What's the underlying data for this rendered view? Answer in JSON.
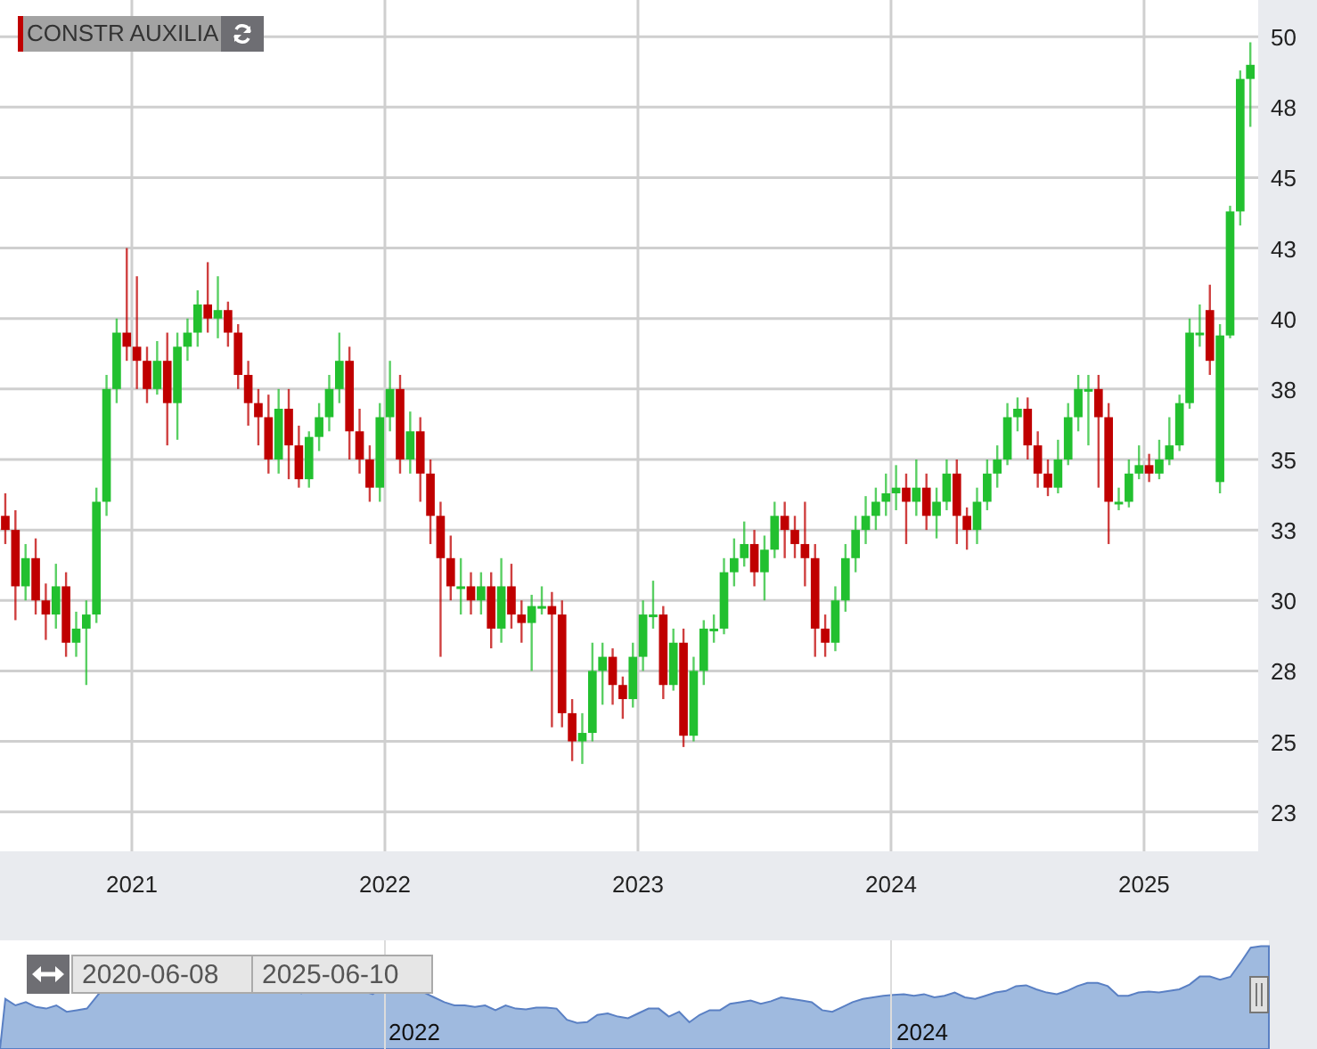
{
  "instrument_label": {
    "text": "CONSTR AUXILIA"
  },
  "chart_data": {
    "type": "candlestick",
    "grid": true,
    "xlim": [
      2020.479,
      2025.451
    ],
    "ylim": [
      21.1,
      51.3
    ],
    "xticks": [
      2021,
      2022,
      2023,
      2024,
      2025
    ],
    "x": [
      2020.5,
      2020.54,
      2020.58,
      2020.62,
      2020.66,
      2020.7,
      2020.74,
      2020.78,
      2020.82,
      2020.86,
      2020.9,
      2020.94,
      2020.98,
      2021.02,
      2021.06,
      2021.1,
      2021.14,
      2021.18,
      2021.22,
      2021.26,
      2021.3,
      2021.34,
      2021.38,
      2021.42,
      2021.46,
      2021.5,
      2021.54,
      2021.58,
      2021.62,
      2021.66,
      2021.7,
      2021.74,
      2021.78,
      2021.82,
      2021.86,
      2021.9,
      2021.94,
      2021.98,
      2022.02,
      2022.06,
      2022.1,
      2022.14,
      2022.18,
      2022.22,
      2022.26,
      2022.3,
      2022.34,
      2022.38,
      2022.42,
      2022.46,
      2022.5,
      2022.54,
      2022.58,
      2022.62,
      2022.66,
      2022.7,
      2022.74,
      2022.78,
      2022.82,
      2022.86,
      2022.9,
      2022.94,
      2022.98,
      2023.02,
      2023.06,
      2023.1,
      2023.14,
      2023.18,
      2023.22,
      2023.26,
      2023.3,
      2023.34,
      2023.38,
      2023.42,
      2023.46,
      2023.5,
      2023.54,
      2023.58,
      2023.62,
      2023.66,
      2023.7,
      2023.74,
      2023.78,
      2023.82,
      2023.86,
      2023.9,
      2023.94,
      2023.98,
      2024.02,
      2024.06,
      2024.1,
      2024.14,
      2024.18,
      2024.22,
      2024.26,
      2024.3,
      2024.34,
      2024.38,
      2024.42,
      2024.46,
      2024.5,
      2024.54,
      2024.58,
      2024.62,
      2024.66,
      2024.7,
      2024.74,
      2024.78,
      2024.82,
      2024.86,
      2024.9,
      2024.94,
      2024.98,
      2025.02,
      2025.06,
      2025.1,
      2025.14,
      2025.18,
      2025.22,
      2025.26,
      2025.3,
      2025.34,
      2025.38,
      2025.42
    ],
    "yticks": [
      {
        "value": 22.5,
        "label": "23"
      },
      {
        "value": 25,
        "label": "25"
      },
      {
        "value": 27.5,
        "label": "28"
      },
      {
        "value": 30,
        "label": "30"
      },
      {
        "value": 32.5,
        "label": "33"
      },
      {
        "value": 35,
        "label": "35"
      },
      {
        "value": 37.5,
        "label": "38"
      },
      {
        "value": 40,
        "label": "40"
      },
      {
        "value": 42.5,
        "label": "43"
      },
      {
        "value": 45,
        "label": "45"
      },
      {
        "value": 47.5,
        "label": "48"
      },
      {
        "value": 50,
        "label": "50"
      }
    ],
    "ohlc": [
      [
        33,
        33.8,
        32,
        32.5
      ],
      [
        32.5,
        33.2,
        29.3,
        30.5
      ],
      [
        30.5,
        32,
        30,
        31.5
      ],
      [
        31.5,
        32.2,
        29.5,
        30
      ],
      [
        30,
        30.6,
        28.6,
        29.5
      ],
      [
        29.5,
        31.3,
        29,
        30.5
      ],
      [
        30.5,
        31,
        28,
        28.5
      ],
      [
        28.5,
        29.6,
        28,
        29
      ],
      [
        29,
        30,
        27,
        29.5
      ],
      [
        29.5,
        34,
        29.2,
        33.5
      ],
      [
        33.5,
        38,
        33,
        37.5
      ],
      [
        37.5,
        40,
        37,
        39.5
      ],
      [
        39.5,
        42.5,
        38.5,
        39
      ],
      [
        39,
        41.5,
        37.5,
        38.5
      ],
      [
        38.5,
        39,
        37,
        37.5
      ],
      [
        37.5,
        39.2,
        37.3,
        38.5
      ],
      [
        38.5,
        39.5,
        35.5,
        37
      ],
      [
        37,
        39.5,
        35.7,
        39
      ],
      [
        39,
        40,
        38.5,
        39.5
      ],
      [
        39.5,
        41,
        39,
        40.5
      ],
      [
        40.5,
        42,
        39.5,
        40
      ],
      [
        40,
        41.5,
        39.3,
        40.3
      ],
      [
        40.3,
        40.6,
        39,
        39.5
      ],
      [
        39.5,
        39.8,
        37.5,
        38
      ],
      [
        38,
        38.5,
        36.2,
        37
      ],
      [
        37,
        37.5,
        35.5,
        36.5
      ],
      [
        36.5,
        37.3,
        34.5,
        35
      ],
      [
        35,
        37.5,
        34.5,
        36.8
      ],
      [
        36.8,
        37.5,
        34.3,
        35.5
      ],
      [
        35.5,
        36.2,
        34,
        34.3
      ],
      [
        34.3,
        36,
        34,
        35.8
      ],
      [
        35.8,
        37,
        35.3,
        36.5
      ],
      [
        36.5,
        38,
        36,
        37.5
      ],
      [
        37.5,
        39.5,
        37,
        38.5
      ],
      [
        38.5,
        39,
        35,
        36
      ],
      [
        36,
        36.8,
        34.5,
        35
      ],
      [
        35,
        35.5,
        33.5,
        34
      ],
      [
        34,
        37,
        33.5,
        36.5
      ],
      [
        36.5,
        38.5,
        36,
        37.5
      ],
      [
        37.5,
        38,
        34.5,
        35
      ],
      [
        35,
        36.7,
        34.5,
        36
      ],
      [
        36,
        36.5,
        33.5,
        34.5
      ],
      [
        34.5,
        35,
        32,
        33
      ],
      [
        33,
        33.5,
        28,
        31.5
      ],
      [
        31.5,
        32.3,
        30,
        30.5
      ],
      [
        30.5,
        31.5,
        29.5,
        30.5
      ],
      [
        30.5,
        31,
        29.5,
        30
      ],
      [
        30,
        31,
        29.5,
        30.5
      ],
      [
        30.5,
        31,
        28.3,
        29
      ],
      [
        29,
        31.5,
        28.5,
        30.5
      ],
      [
        30.5,
        31.3,
        29,
        29.5
      ],
      [
        29.5,
        30,
        28.5,
        29.2
      ],
      [
        29.2,
        30.2,
        27.5,
        29.8
      ],
      [
        29.8,
        30.5,
        29.5,
        29.8
      ],
      [
        29.8,
        30.3,
        25.5,
        29.5
      ],
      [
        29.5,
        30,
        25.5,
        26
      ],
      [
        26,
        26.5,
        24.3,
        25
      ],
      [
        25,
        26,
        24.2,
        25.3
      ],
      [
        25.3,
        28.5,
        25,
        27.5
      ],
      [
        27.5,
        28.5,
        26.3,
        28
      ],
      [
        28,
        28.3,
        26.3,
        27
      ],
      [
        27,
        27.3,
        25.8,
        26.5
      ],
      [
        26.5,
        28.5,
        26.2,
        28
      ],
      [
        28,
        30,
        27.5,
        29.5
      ],
      [
        29.5,
        30.7,
        29,
        29.5
      ],
      [
        29.5,
        29.8,
        26.5,
        27
      ],
      [
        27,
        29,
        26.8,
        28.5
      ],
      [
        28.5,
        29,
        24.8,
        25.2
      ],
      [
        25.2,
        28,
        25,
        27.5
      ],
      [
        27.5,
        29.3,
        27,
        29
      ],
      [
        29,
        29.5,
        28.5,
        29
      ],
      [
        29,
        31.5,
        28.8,
        31
      ],
      [
        31,
        32.2,
        30.5,
        31.5
      ],
      [
        31.5,
        32.8,
        31.2,
        32
      ],
      [
        32,
        32.5,
        30.5,
        31
      ],
      [
        31,
        32.3,
        30,
        31.8
      ],
      [
        31.8,
        33.5,
        31.5,
        33
      ],
      [
        33,
        33.5,
        31.5,
        32.5
      ],
      [
        32.5,
        33,
        31.5,
        32
      ],
      [
        32,
        33.5,
        30.5,
        31.5
      ],
      [
        31.5,
        32,
        28,
        29
      ],
      [
        29,
        29.5,
        28,
        28.5
      ],
      [
        28.5,
        30.5,
        28.2,
        30
      ],
      [
        30,
        32,
        29.6,
        31.5
      ],
      [
        31.5,
        33,
        31,
        32.5
      ],
      [
        32.5,
        33.7,
        32,
        33
      ],
      [
        33,
        34,
        32.5,
        33.5
      ],
      [
        33.5,
        34.5,
        33,
        33.8
      ],
      [
        33.8,
        34.8,
        33.2,
        34
      ],
      [
        34,
        34.5,
        32,
        33.5
      ],
      [
        33.5,
        35,
        33,
        34
      ],
      [
        34,
        34.5,
        32.5,
        33
      ],
      [
        33,
        34,
        32.2,
        33.5
      ],
      [
        33.5,
        35,
        33.2,
        34.5
      ],
      [
        34.5,
        35,
        32,
        33
      ],
      [
        33,
        33.3,
        31.8,
        32.5
      ],
      [
        32.5,
        34,
        32,
        33.5
      ],
      [
        33.5,
        35,
        33.2,
        34.5
      ],
      [
        34.5,
        35.5,
        34,
        35
      ],
      [
        35,
        37,
        34.8,
        36.5
      ],
      [
        36.5,
        37.2,
        36,
        36.8
      ],
      [
        36.8,
        37.2,
        35,
        35.5
      ],
      [
        35.5,
        36,
        34,
        34.5
      ],
      [
        34.5,
        35,
        33.7,
        34
      ],
      [
        34,
        35.7,
        33.8,
        35
      ],
      [
        35,
        37,
        34.8,
        36.5
      ],
      [
        36.5,
        38,
        36,
        37.5
      ],
      [
        37.5,
        38,
        35.5,
        37.5
      ],
      [
        37.5,
        38,
        34,
        36.5
      ],
      [
        36.5,
        37,
        32,
        33.5
      ],
      [
        33.5,
        34,
        33.2,
        33.5
      ],
      [
        33.5,
        35,
        33.3,
        34.5
      ],
      [
        34.5,
        35.5,
        34.3,
        34.8
      ],
      [
        34.8,
        35.2,
        34.2,
        34.5
      ],
      [
        34.5,
        35.7,
        34.3,
        35
      ],
      [
        35,
        36.5,
        34.8,
        35.5
      ],
      [
        35.5,
        37.3,
        35.3,
        37
      ],
      [
        37,
        40,
        36.8,
        39.5
      ],
      [
        39.5,
        40.5,
        39,
        39.5
      ],
      [
        40.3,
        41.2,
        38,
        38.5
      ],
      [
        34.2,
        39.8,
        33.8,
        39.4
      ],
      [
        39.4,
        44,
        39.3,
        43.8
      ],
      [
        43.8,
        48.8,
        43.3,
        48.5
      ],
      [
        48.5,
        49.8,
        46.8,
        49
      ]
    ]
  },
  "navigator": {
    "range_from": "2020-06-08",
    "range_to": "2025-06-10",
    "axis_labels": [
      "2022",
      "2024"
    ]
  }
}
